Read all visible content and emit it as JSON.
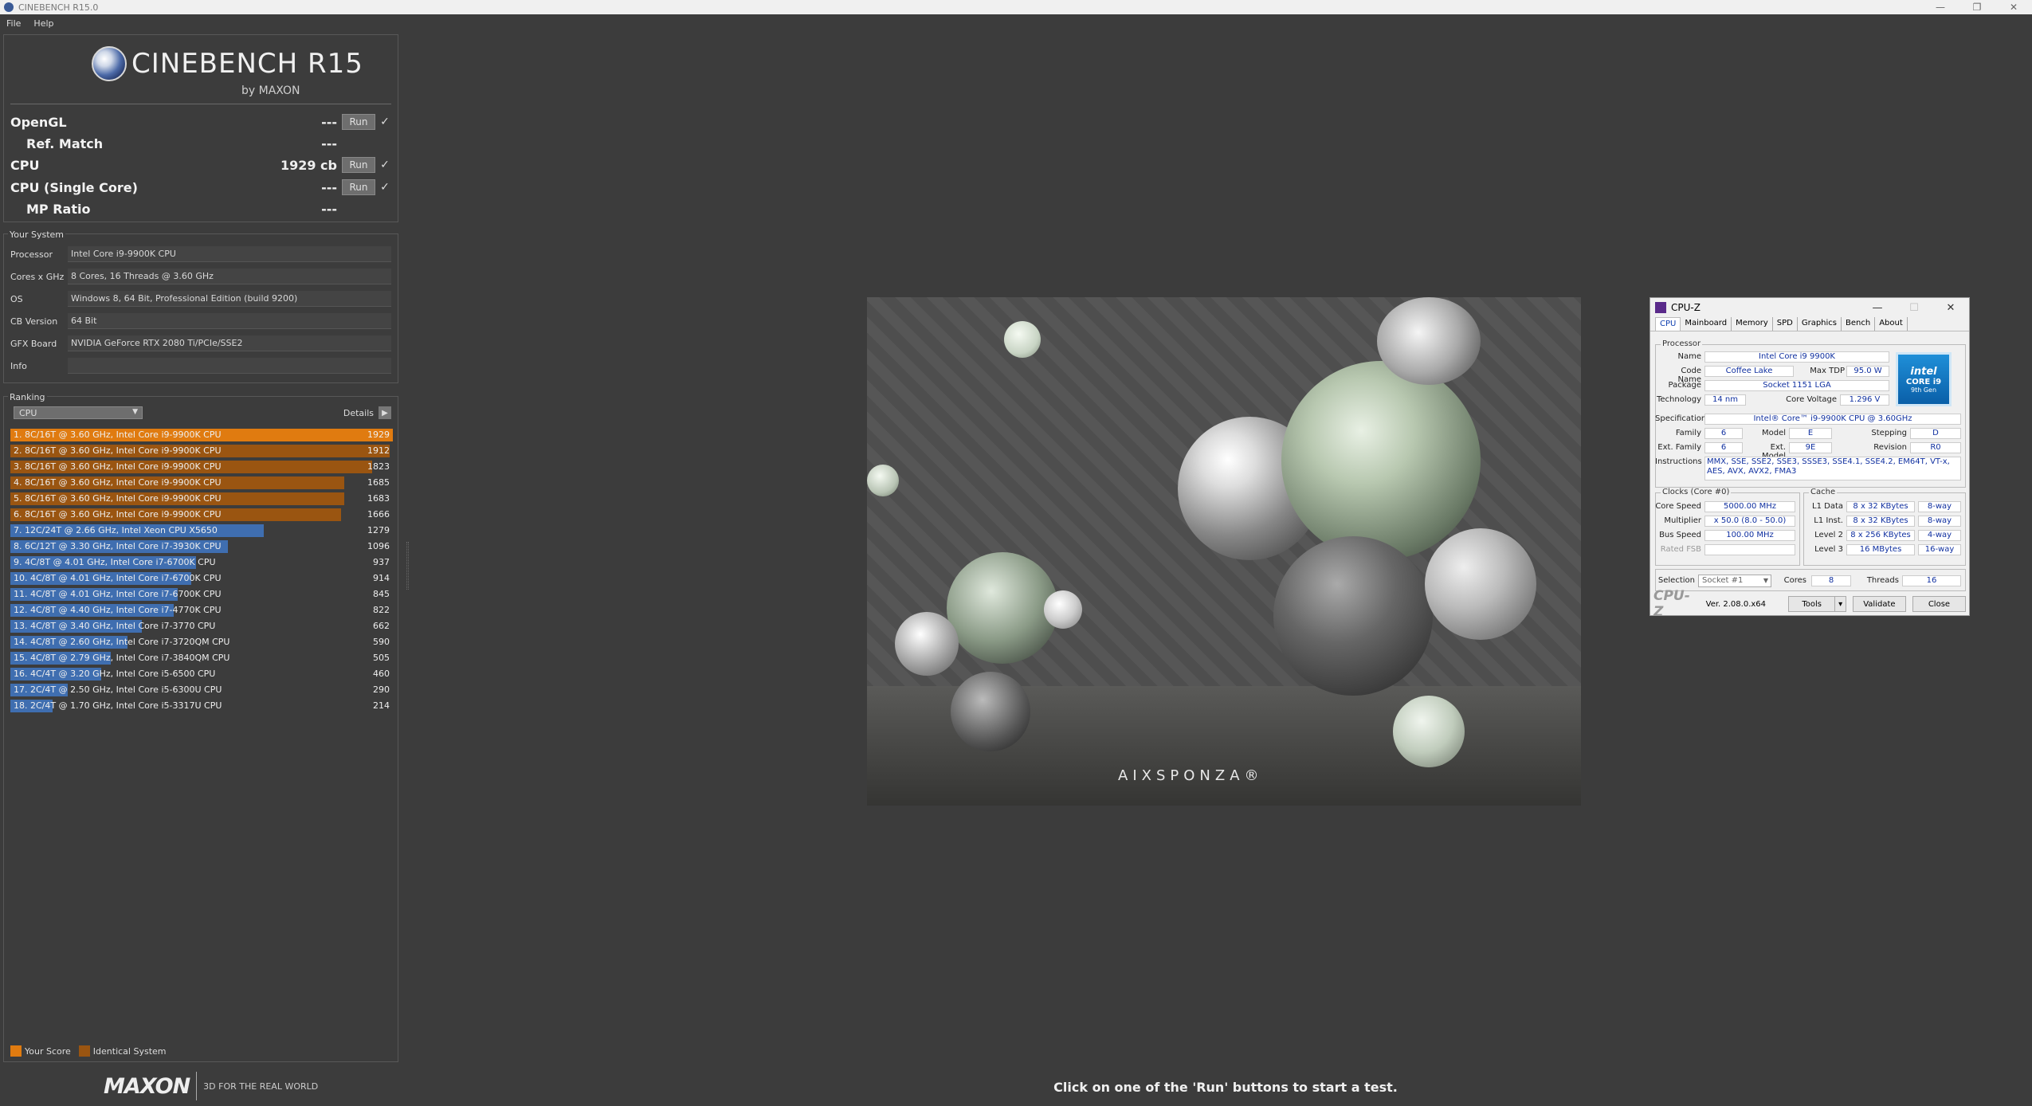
{
  "window": {
    "title": "CINEBENCH R15.0"
  },
  "menu": [
    "File",
    "Help"
  ],
  "logo": {
    "name": "CINEBENCH R15",
    "by": "by MAXON"
  },
  "tests": [
    {
      "name": "OpenGL",
      "value": "---",
      "run": "Run",
      "check": "✓",
      "indent": false
    },
    {
      "name": "Ref. Match",
      "value": "---",
      "indent": true
    },
    {
      "name": "CPU",
      "value": "1929 cb",
      "run": "Run",
      "check": "✓",
      "indent": false
    },
    {
      "name": "CPU (Single Core)",
      "value": "---",
      "run": "Run",
      "check": "✓",
      "indent": false
    },
    {
      "name": "MP Ratio",
      "value": "---",
      "indent": true
    }
  ],
  "your_system": {
    "label": "Your System",
    "rows": [
      {
        "label": "Processor",
        "value": "Intel Core i9-9900K CPU"
      },
      {
        "label": "Cores x GHz",
        "value": "8 Cores, 16 Threads @ 3.60 GHz"
      },
      {
        "label": "OS",
        "value": "Windows 8, 64 Bit, Professional Edition (build 9200)"
      },
      {
        "label": "CB Version",
        "value": "64 Bit"
      },
      {
        "label": "GFX Board",
        "value": "NVIDIA GeForce RTX 2080 Ti/PCIe/SSE2"
      },
      {
        "label": "Info",
        "value": ""
      }
    ]
  },
  "ranking": {
    "label": "Ranking",
    "dropdown": "CPU",
    "details": "Details",
    "max": 1929,
    "rows": [
      {
        "text": "1. 8C/16T @ 3.60 GHz, Intel Core i9-9900K CPU",
        "value": 1929,
        "kind": "your"
      },
      {
        "text": "2. 8C/16T @ 3.60 GHz, Intel Core i9-9900K CPU",
        "value": 1912,
        "kind": "identical"
      },
      {
        "text": "3. 8C/16T @ 3.60 GHz, Intel Core i9-9900K CPU",
        "value": 1823,
        "kind": "identical"
      },
      {
        "text": "4. 8C/16T @ 3.60 GHz, Intel Core i9-9900K CPU",
        "value": 1685,
        "kind": "identical"
      },
      {
        "text": "5. 8C/16T @ 3.60 GHz, Intel Core i9-9900K CPU",
        "value": 1683,
        "kind": "identical"
      },
      {
        "text": "6. 8C/16T @ 3.60 GHz, Intel Core i9-9900K CPU",
        "value": 1666,
        "kind": "identical"
      },
      {
        "text": "7. 12C/24T @ 2.66 GHz, Intel Xeon CPU X5650",
        "value": 1279,
        "kind": "other"
      },
      {
        "text": "8. 6C/12T @ 3.30 GHz,  Intel Core i7-3930K CPU",
        "value": 1096,
        "kind": "other"
      },
      {
        "text": "9. 4C/8T @ 4.01 GHz, Intel Core i7-6700K CPU",
        "value": 937,
        "kind": "other"
      },
      {
        "text": "10. 4C/8T @ 4.01 GHz, Intel Core i7-6700K CPU",
        "value": 914,
        "kind": "other"
      },
      {
        "text": "11. 4C/8T @ 4.01 GHz, Intel Core i7-6700K CPU",
        "value": 845,
        "kind": "other"
      },
      {
        "text": "12. 4C/8T @ 4.40 GHz, Intel Core i7-4770K CPU",
        "value": 822,
        "kind": "other"
      },
      {
        "text": "13. 4C/8T @ 3.40 GHz,  Intel Core i7-3770 CPU",
        "value": 662,
        "kind": "other"
      },
      {
        "text": "14. 4C/8T @ 2.60 GHz, Intel Core i7-3720QM CPU",
        "value": 590,
        "kind": "other"
      },
      {
        "text": "15. 4C/8T @ 2.79 GHz, Intel Core i7-3840QM CPU",
        "value": 505,
        "kind": "other"
      },
      {
        "text": "16. 4C/4T @ 3.20 GHz, Intel Core i5-6500 CPU",
        "value": 460,
        "kind": "other"
      },
      {
        "text": "17. 2C/4T @ 2.50 GHz, Intel Core i5-6300U CPU",
        "value": 290,
        "kind": "other"
      },
      {
        "text": "18. 2C/4T @ 1.70 GHz,  Intel Core i5-3317U CPU",
        "value": 214,
        "kind": "other"
      }
    ],
    "legend": {
      "your": "Your Score",
      "identical": "Identical System"
    }
  },
  "colors": {
    "your": "#e07b10",
    "identical": "#9a5511",
    "other": "#3f6eb0"
  },
  "footer": {
    "brand": "MAXON",
    "tagline": "3D FOR THE REAL WORLD"
  },
  "render": {
    "watermark": "AIXSPONZA®"
  },
  "status": "Click on one of the 'Run' buttons to start a test.",
  "cpuz": {
    "title": "CPU-Z",
    "tabs": [
      "CPU",
      "Mainboard",
      "Memory",
      "SPD",
      "Graphics",
      "Bench",
      "About"
    ],
    "processor_label": "Processor",
    "name_label": "Name",
    "name": "Intel Core i9 9900K",
    "codename_label": "Code Name",
    "codename": "Coffee Lake",
    "maxtdp_label": "Max TDP",
    "maxtdp": "95.0 W",
    "package_label": "Package",
    "package": "Socket 1151 LGA",
    "tech_label": "Technology",
    "tech": "14 nm",
    "voltage_label": "Core Voltage",
    "voltage": "1.296 V",
    "spec_label": "Specification",
    "spec": "Intel® Core™ i9-9900K CPU @ 3.60GHz",
    "family_label": "Family",
    "family": "6",
    "model_label": "Model",
    "model": "E",
    "stepping_label": "Stepping",
    "stepping": "D",
    "extfamily_label": "Ext. Family",
    "extfamily": "6",
    "extmodel_label": "Ext. Model",
    "extmodel": "9E",
    "revision_label": "Revision",
    "revision": "R0",
    "instr_label": "Instructions",
    "instr": "MMX, SSE, SSE2, SSE3, SSSE3, SSE4.1, SSE4.2, EM64T, VT-x, AES, AVX, AVX2, FMA3",
    "intel_badge": {
      "brand": "intel",
      "line": "CORE i9",
      "gen": "9th Gen"
    },
    "clocks_label": "Clocks (Core #0)",
    "corespeed_label": "Core Speed",
    "corespeed": "5000.00 MHz",
    "mult_label": "Multiplier",
    "mult": "x 50.0 (8.0 - 50.0)",
    "bus_label": "Bus Speed",
    "bus": "100.00 MHz",
    "fsb_label": "Rated FSB",
    "fsb": "",
    "cache_label": "Cache",
    "l1d_label": "L1 Data",
    "l1d": "8 x 32 KBytes",
    "l1d_way": "8-way",
    "l1i_label": "L1 Inst.",
    "l1i": "8 x 32 KBytes",
    "l1i_way": "8-way",
    "l2_label": "Level 2",
    "l2": "8 x 256 KBytes",
    "l2_way": "4-way",
    "l3_label": "Level 3",
    "l3": "16 MBytes",
    "l3_way": "16-way",
    "selection_label": "Selection",
    "selection": "Socket #1",
    "cores_label": "Cores",
    "cores": "8",
    "threads_label": "Threads",
    "threads": "16",
    "brand": "CPU-Z",
    "version": "Ver. 2.08.0.x64",
    "tools": "Tools",
    "validate": "Validate",
    "close": "Close"
  }
}
